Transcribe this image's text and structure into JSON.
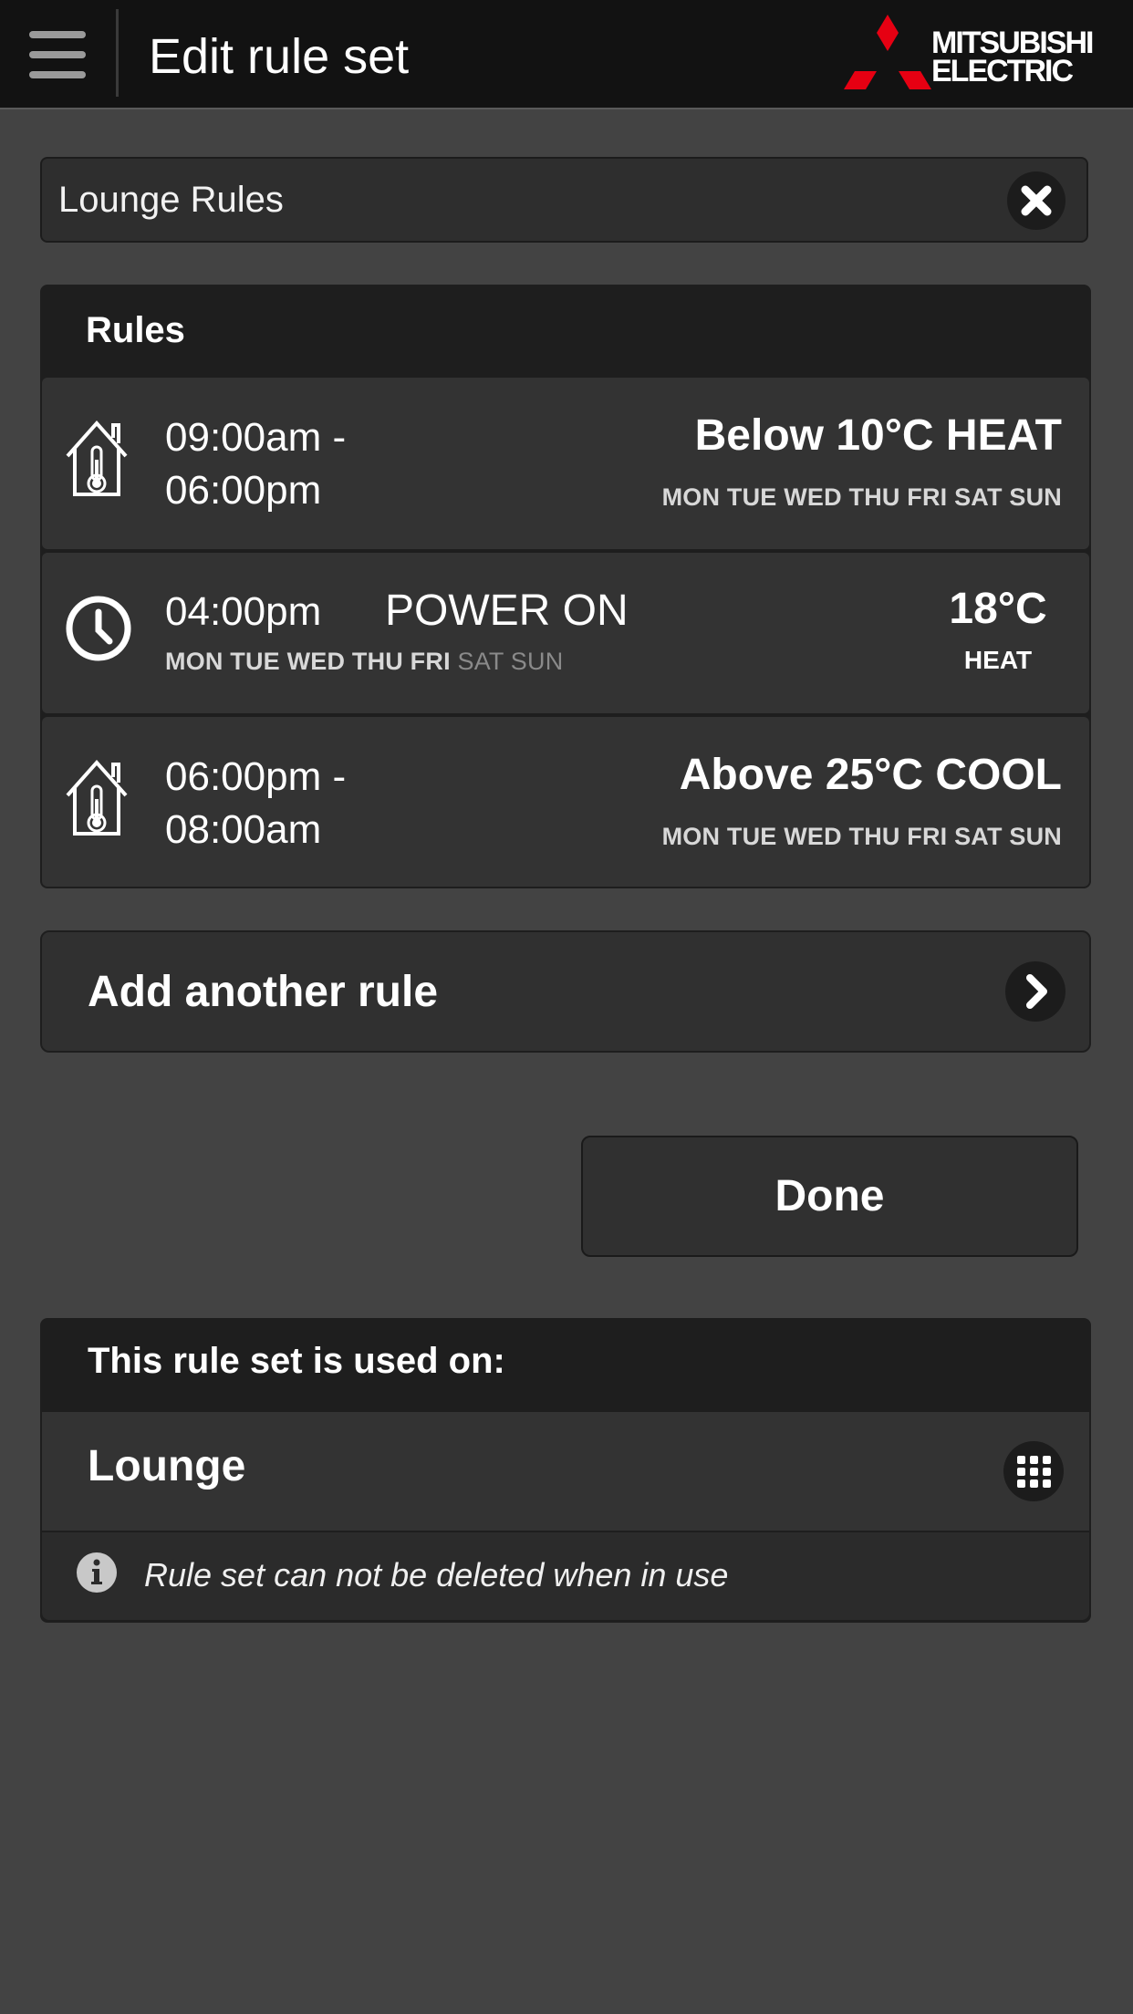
{
  "header": {
    "title": "Edit rule set",
    "menu_icon": "hamburger-menu-icon",
    "brand": {
      "line1": "MITSUBISHI",
      "line2": "ELECTRIC",
      "accent": "#e60012"
    }
  },
  "name_field": {
    "value": "Lounge Rules",
    "clear_icon": "close-icon"
  },
  "rules": {
    "heading": "Rules",
    "items": [
      {
        "icon": "house-thermometer-icon",
        "time_start": "09:00am -",
        "time_end": "06:00pm",
        "condition": "Below 10°C HEAT",
        "days_on": "MON TUE WED THU FRI SAT SUN",
        "days_off": ""
      },
      {
        "icon": "clock-icon",
        "time": "04:00pm",
        "action": "POWER ON",
        "temperature": "18°C",
        "mode": "HEAT",
        "days_on": "MON TUE WED THU FRI",
        "days_off": "SAT SUN"
      },
      {
        "icon": "house-thermometer-icon",
        "time_start": "06:00pm -",
        "time_end": "08:00am",
        "condition": "Above 25°C COOL",
        "days_on": "MON TUE WED THU FRI SAT SUN",
        "days_off": ""
      }
    ]
  },
  "add_rule": {
    "label": "Add another rule",
    "icon": "chevron-right-icon"
  },
  "done_button": {
    "label": "Done"
  },
  "used_on": {
    "heading": "This rule set is used on:",
    "items": [
      {
        "label": "Lounge",
        "icon": "keypad-grid-icon"
      }
    ],
    "info_icon": "info-icon",
    "info_text": "Rule set can not be deleted when in use"
  },
  "colors": {
    "background": "#434343",
    "header": "#121212",
    "panel_header": "#1e1e1e",
    "row": "#333333",
    "days_inactive": "#8a8a8a"
  }
}
